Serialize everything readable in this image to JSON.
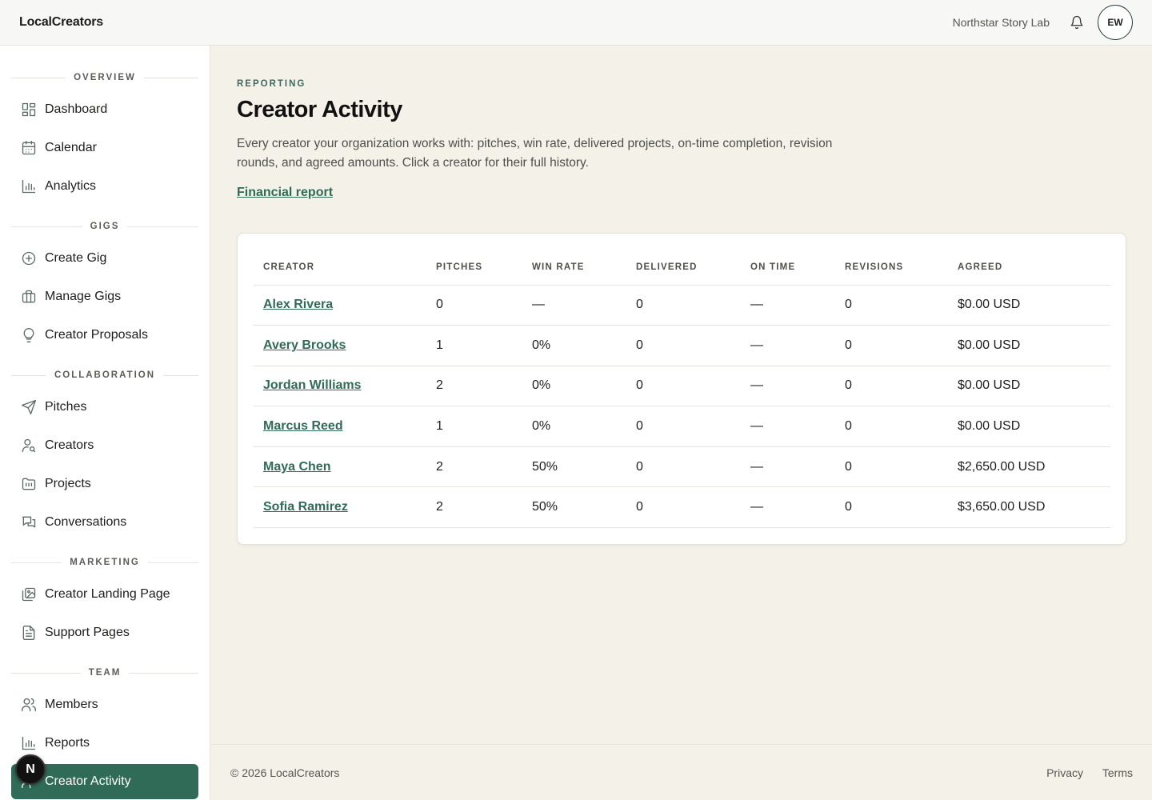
{
  "topbar": {
    "brand": "LocalCreators",
    "org_name": "Northstar Story Lab",
    "avatar_initials": "EW"
  },
  "sidebar": {
    "sections": [
      {
        "title": "OVERVIEW",
        "items": [
          {
            "label": "Dashboard",
            "icon": "dashboard-icon"
          },
          {
            "label": "Calendar",
            "icon": "calendar-icon"
          },
          {
            "label": "Analytics",
            "icon": "bar-chart-icon"
          }
        ]
      },
      {
        "title": "GIGS",
        "items": [
          {
            "label": "Create Gig",
            "icon": "plus-circle-icon"
          },
          {
            "label": "Manage Gigs",
            "icon": "briefcase-icon"
          },
          {
            "label": "Creator Proposals",
            "icon": "lightbulb-icon"
          }
        ]
      },
      {
        "title": "COLLABORATION",
        "items": [
          {
            "label": "Pitches",
            "icon": "send-icon"
          },
          {
            "label": "Creators",
            "icon": "user-search-icon"
          },
          {
            "label": "Projects",
            "icon": "folder-icon"
          },
          {
            "label": "Conversations",
            "icon": "chat-icon"
          }
        ]
      },
      {
        "title": "MARKETING",
        "items": [
          {
            "label": "Creator Landing Page",
            "icon": "image-gallery-icon"
          },
          {
            "label": "Support Pages",
            "icon": "document-icon"
          }
        ]
      },
      {
        "title": "TEAM",
        "items": [
          {
            "label": "Members",
            "icon": "users-icon"
          },
          {
            "label": "Reports",
            "icon": "bar-chart-icon"
          },
          {
            "label": "Creator Activity",
            "icon": "user-activity-icon",
            "active": true
          }
        ]
      }
    ],
    "floating_badge": "N"
  },
  "main": {
    "eyebrow": "REPORTING",
    "title": "Creator Activity",
    "description": "Every creator your organization works with: pitches, win rate, delivered projects, on-time completion, revision rounds, and agreed amounts. Click a creator for their full history.",
    "financial_link": "Financial report"
  },
  "table": {
    "columns": [
      "CREATOR",
      "PITCHES",
      "WIN RATE",
      "DELIVERED",
      "ON TIME",
      "REVISIONS",
      "AGREED"
    ],
    "rows": [
      [
        "Alex Rivera",
        "0",
        "—",
        "0",
        "—",
        "0",
        "$0.00 USD"
      ],
      [
        "Avery Brooks",
        "1",
        "0%",
        "0",
        "—",
        "0",
        "$0.00 USD"
      ],
      [
        "Jordan Williams",
        "2",
        "0%",
        "0",
        "—",
        "0",
        "$0.00 USD"
      ],
      [
        "Marcus Reed",
        "1",
        "0%",
        "0",
        "—",
        "0",
        "$0.00 USD"
      ],
      [
        "Maya Chen",
        "2",
        "50%",
        "0",
        "—",
        "0",
        "$2,650.00 USD"
      ],
      [
        "Sofia Ramirez",
        "2",
        "50%",
        "0",
        "—",
        "0",
        "$3,650.00 USD"
      ]
    ]
  },
  "footer": {
    "copyright": "© 2026 LocalCreators",
    "privacy": "Privacy",
    "terms": "Terms"
  },
  "colors": {
    "accent": "#2f6b57",
    "background": "#f4f1e8"
  }
}
